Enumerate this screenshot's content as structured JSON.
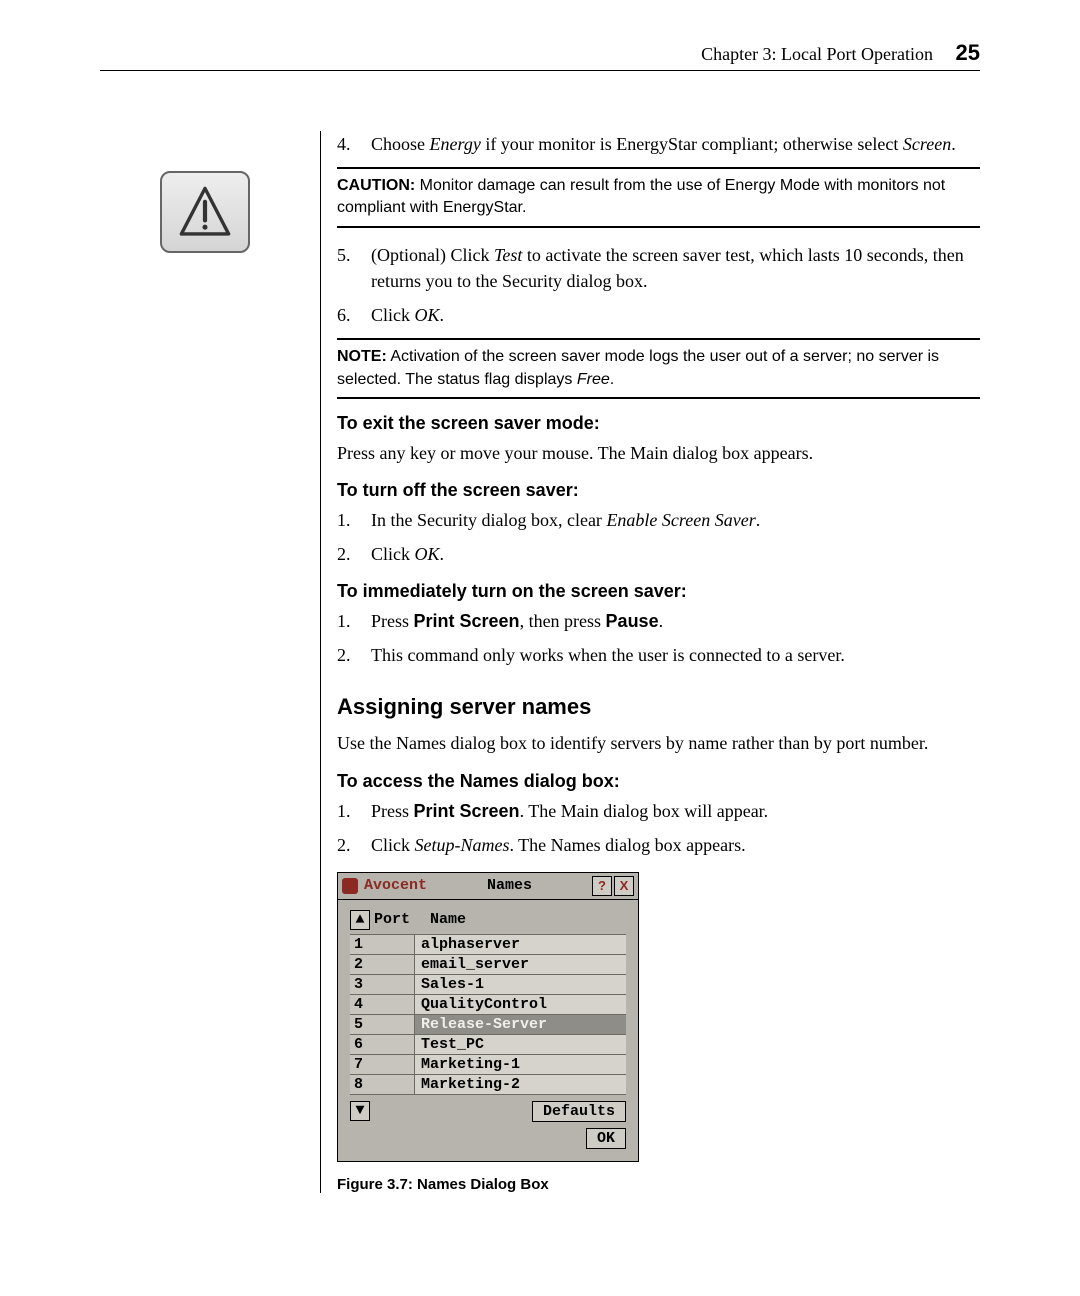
{
  "header": {
    "chapter": "Chapter 3: Local Port Operation",
    "page": "25"
  },
  "steps_top": [
    {
      "num": "4.",
      "pre": "Choose ",
      "em1": "Energy",
      "mid": " if your monitor is EnergyStar compliant; otherwise select ",
      "em2": "Screen",
      "post": "."
    }
  ],
  "caution": {
    "lead": "CAUTION:",
    "text": " Monitor damage can result from the use of Energy Mode with monitors not compliant with EnergyStar."
  },
  "steps_mid": [
    {
      "num": "5.",
      "pre": "(Optional) Click ",
      "em1": "Test",
      "post": " to activate the screen saver test, which lasts 10 seconds, then returns you to the Security dialog box."
    },
    {
      "num": "6.",
      "pre": "Click ",
      "em1": "OK",
      "post": "."
    }
  ],
  "note": {
    "lead": "NOTE:",
    "text": " Activation of the screen saver mode logs the user out of a server; no server is selected. The status flag displays ",
    "em": "Free",
    "post": "."
  },
  "exit": {
    "head": "To exit the screen saver mode:",
    "body": "Press any key or move your mouse. The Main dialog box appears."
  },
  "turn_off": {
    "head": "To turn off the screen saver:",
    "steps": [
      {
        "num": "1.",
        "pre": "In the Security dialog box, clear ",
        "em1": "Enable Screen Saver",
        "post": "."
      },
      {
        "num": "2.",
        "pre": "Click ",
        "em1": "OK",
        "post": "."
      }
    ]
  },
  "immediate": {
    "head": "To immediately turn on the screen saver:",
    "steps": [
      {
        "num": "1.",
        "pre": "Press ",
        "b1": "Print Screen",
        "mid": ", then press ",
        "b2": "Pause",
        "post": "."
      },
      {
        "num": "2.",
        "text": "This command only works when the user is connected to a server."
      }
    ]
  },
  "section2": {
    "title": "Assigning server names",
    "intro": "Use the Names dialog box to identify servers by name rather than by port number.",
    "head": "To access the Names dialog box:",
    "steps": [
      {
        "num": "1.",
        "pre": "Press ",
        "b1": "Print Screen",
        "post": ". The Main dialog box will appear."
      },
      {
        "num": "2.",
        "pre": "Click ",
        "em1": "Setup-Names",
        "post": ". The Names dialog box appears."
      }
    ]
  },
  "dialog": {
    "brand": "Avocent",
    "title": "Names",
    "help": "?",
    "close": "X",
    "sort": "▲",
    "col_port": "Port",
    "col_name": "Name",
    "rows": [
      {
        "port": "1",
        "name": "alphaserver",
        "sel": false
      },
      {
        "port": "2",
        "name": "email_server",
        "sel": false
      },
      {
        "port": "3",
        "name": "Sales-1",
        "sel": false
      },
      {
        "port": "4",
        "name": "QualityControl",
        "sel": false
      },
      {
        "port": "5",
        "name": "Release-Server",
        "sel": true
      },
      {
        "port": "6",
        "name": "Test_PC",
        "sel": false
      },
      {
        "port": "7",
        "name": "Marketing-1",
        "sel": false
      },
      {
        "port": "8",
        "name": "Marketing-2",
        "sel": false
      }
    ],
    "more": "▼",
    "defaults": "Defaults",
    "ok": "OK"
  },
  "figure": "Figure 3.7: Names Dialog Box"
}
